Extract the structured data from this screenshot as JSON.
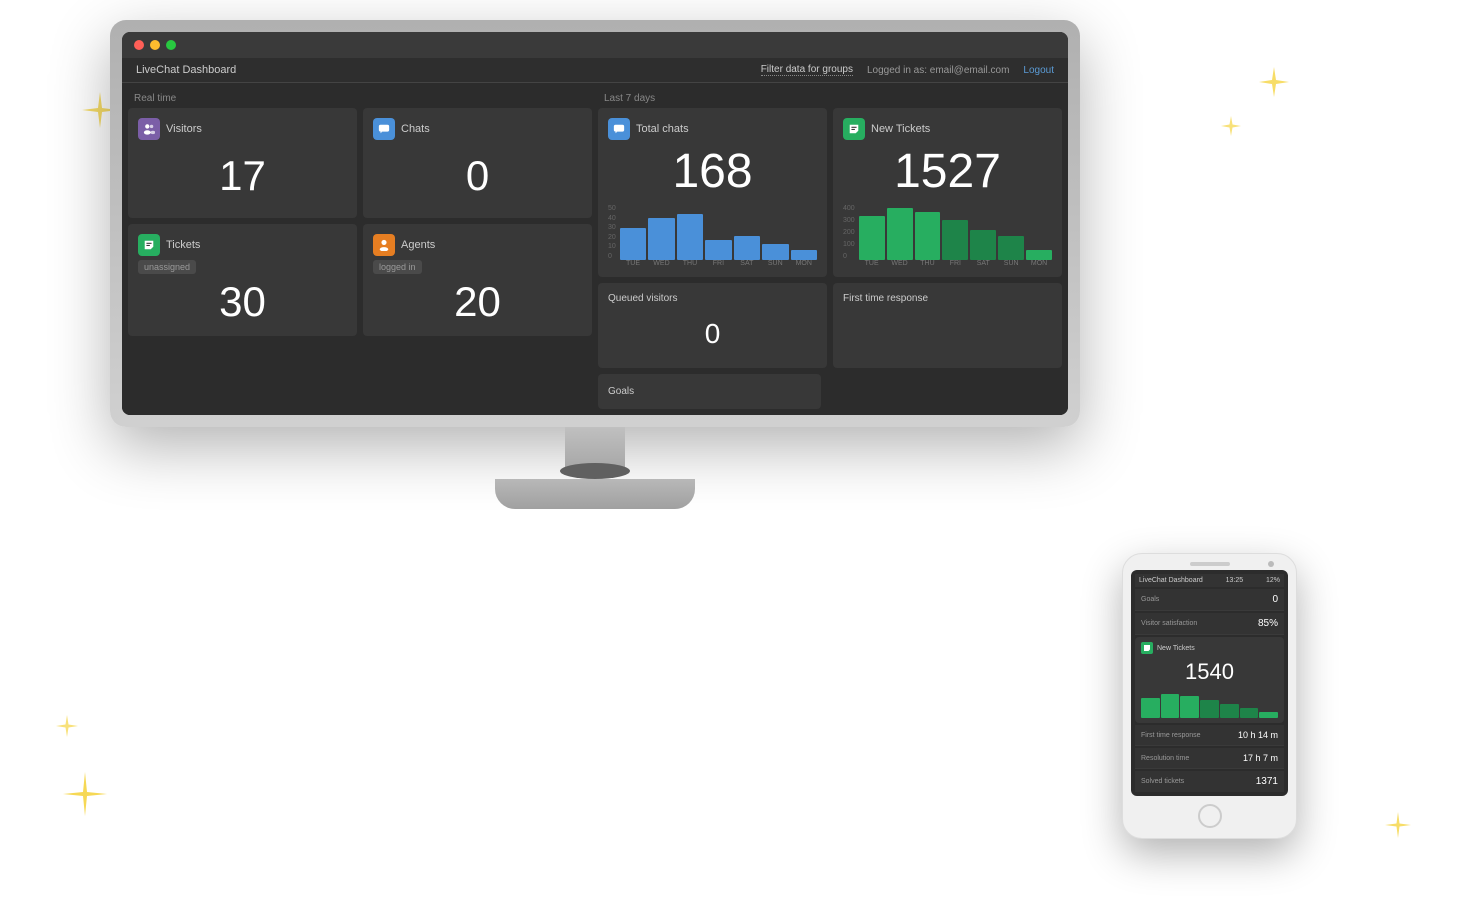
{
  "app": {
    "title": "LiveChat Dashboard",
    "filter_label": "Filter data for groups",
    "login_label": "Logged in as: email@email.com",
    "logout_label": "Logout"
  },
  "sections": {
    "realtime": "Real time",
    "last7days": "Last 7 days"
  },
  "cards": {
    "visitors": {
      "title": "Visitors",
      "icon": "visitors-icon",
      "value": "17"
    },
    "chats": {
      "title": "Chats",
      "icon": "chats-icon",
      "value": "0"
    },
    "tickets": {
      "title": "Tickets",
      "subtitle": "unassigned",
      "icon": "tickets-icon",
      "value": "30"
    },
    "agents": {
      "title": "Agents",
      "subtitle": "logged in",
      "icon": "agents-icon",
      "value": "20"
    },
    "total_chats": {
      "title": "Total chats",
      "icon": "total-chats-icon",
      "value": "168"
    },
    "new_tickets": {
      "title": "New Tickets",
      "icon": "new-tickets-icon",
      "value": "1527"
    },
    "queued_visitors": {
      "title": "Queued visitors",
      "value": "0"
    },
    "goals": {
      "title": "Goals"
    },
    "first_time_response": {
      "title": "First time response"
    }
  },
  "charts": {
    "total_chats": {
      "bars": [
        28,
        38,
        42,
        18,
        22,
        15,
        10
      ],
      "labels": [
        "TUE",
        "WED",
        "THU",
        "FRI",
        "SAT",
        "SUN",
        "MON"
      ],
      "yLabels": [
        "50",
        "40",
        "30",
        "20",
        "10",
        "0"
      ]
    },
    "new_tickets": {
      "bars": [
        320,
        380,
        350,
        290,
        220,
        180,
        80
      ],
      "labels": [
        "TUE",
        "WED",
        "THU",
        "FRI",
        "SAT",
        "SUN",
        "MON"
      ],
      "yLabels": [
        "400",
        "300",
        "200",
        "100",
        "0"
      ]
    }
  },
  "phone": {
    "time": "13:25",
    "battery": "12%",
    "title": "LiveChat Dashboard",
    "goals_value": "0",
    "visitor_satisfaction": "85%",
    "new_tickets_value": "1540",
    "first_time_response": "10 h 14 m",
    "resolution_time": "17 h 7 m",
    "solved_tickets": "1371",
    "stats": [
      {
        "label": "Goals",
        "value": "0"
      },
      {
        "label": "Visitor satisfaction",
        "value": "85 %"
      }
    ]
  }
}
